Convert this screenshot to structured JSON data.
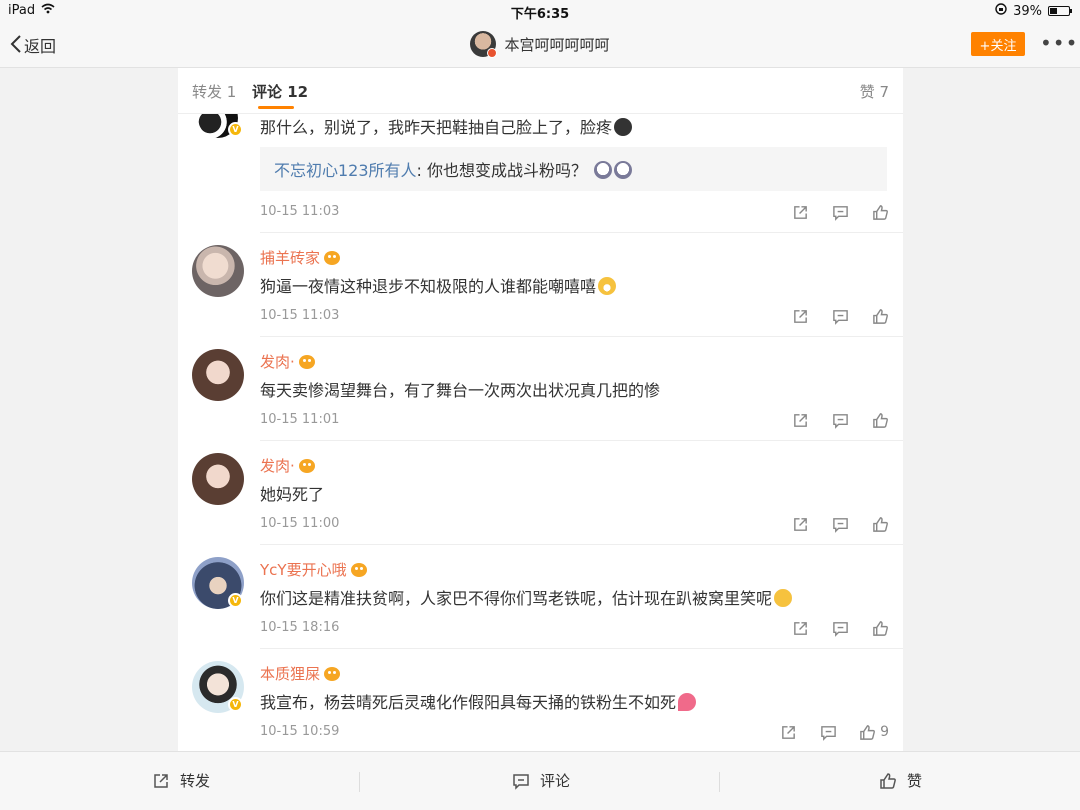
{
  "status": {
    "device": "iPad",
    "time": "下午6:35",
    "battery": "39%",
    "battery_level": 0.39
  },
  "nav": {
    "back_label": "返回",
    "title": "本宫呵呵呵呵呵",
    "follow_label": "+关注",
    "more_label": "•••"
  },
  "tabs": {
    "repost": "转发 1",
    "comment": "评论 12",
    "like": "赞 7"
  },
  "comments": [
    {
      "name": "",
      "text": "那什么，别说了，我昨天把鞋抽自己脸上了，脸疼",
      "reply_name": "不忘初心123所有人",
      "reply_text": ": 你也想变成战斗粉吗？",
      "time": "10-15 11:03",
      "verified": true
    },
    {
      "name": "捕羊砖家",
      "text": "狗逼一夜情这种退步不知极限的人谁都能嘲嘻嘻",
      "time": "10-15 11:03"
    },
    {
      "name": "发肉·",
      "text": "每天卖惨渴望舞台，有了舞台一次两次出状况真几把的惨",
      "time": "10-15 11:01"
    },
    {
      "name": "发肉·",
      "text": "她妈死了",
      "time": "10-15 11:00"
    },
    {
      "name": "YcY要开心哦",
      "text": "你们这是精准扶贫啊，人家巴不得你们骂老铁呢，估计现在趴被窝里笑呢",
      "time": "10-15 18:16",
      "verified": true
    },
    {
      "name": "本质狸屎",
      "text": "我宣布，杨芸晴死后灵魂化作假阳具每天捅的铁粉生不如死",
      "time": "10-15 10:59",
      "likes": "9",
      "verified": true
    }
  ],
  "bottom": {
    "repost": "转发",
    "comment": "评论",
    "like": "赞"
  },
  "colors": {
    "accent": "#ff8200",
    "username": "#eb7350",
    "reply_link": "#4f7cae"
  }
}
